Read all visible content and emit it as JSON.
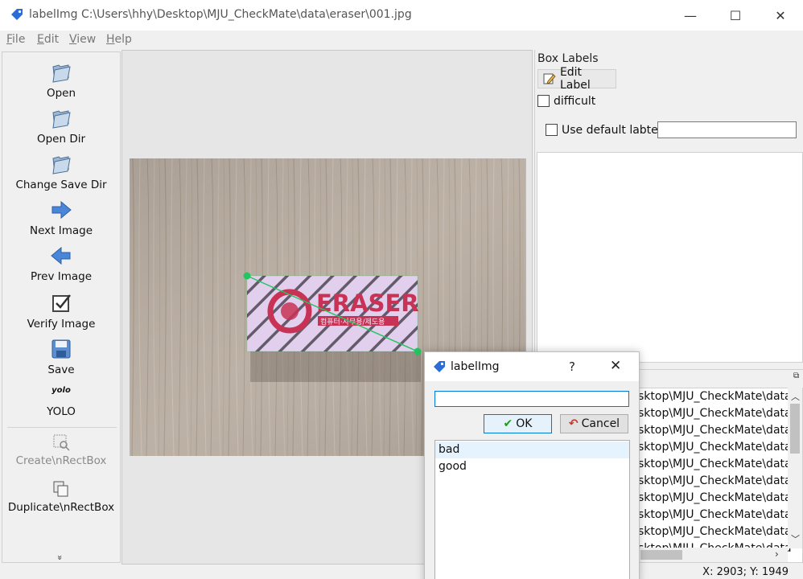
{
  "window": {
    "title": "labelImg C:\\Users\\hhy\\Desktop\\MJU_CheckMate\\data\\eraser\\001.jpg",
    "minimize_glyph": "—",
    "maximize_glyph": "☐",
    "close_glyph": "✕"
  },
  "menu": {
    "file": {
      "mnemonic": "F",
      "rest": "ile"
    },
    "edit": {
      "mnemonic": "E",
      "rest": "dit"
    },
    "view": {
      "mnemonic": "V",
      "rest": "iew"
    },
    "help": {
      "mnemonic": "H",
      "rest": "elp"
    }
  },
  "toolbar": {
    "open": "Open",
    "open_dir": "Open Dir",
    "change_save_dir": "Change Save Dir",
    "next_image": "Next Image",
    "prev_image": "Prev Image",
    "verify_image": "Verify Image",
    "save": "Save",
    "yolo_icon_text": "yolo",
    "yolo": "YOLO",
    "create_rectbox": "Create\\nRectBox",
    "duplicate_rectbox": "Duplicate\\nRectBox",
    "more": "»"
  },
  "canvas": {
    "product_text": "ERASER",
    "product_subtext": "컴퓨터·사무용/제도용"
  },
  "box_labels": {
    "title": "Box Labels",
    "edit_label": "Edit Label",
    "difficult": "difficult",
    "use_default_label": "Use default labtel",
    "default_label_value": ""
  },
  "file_list": {
    "rows": [
      "sktop\\MJU_CheckMate\\data",
      "sktop\\MJU_CheckMate\\data",
      "sktop\\MJU_CheckMate\\data",
      "sktop\\MJU_CheckMate\\data",
      "sktop\\MJU_CheckMate\\data",
      "sktop\\MJU_CheckMate\\data",
      "sktop\\MJU_CheckMate\\data",
      "sktop\\MJU_CheckMate\\data",
      "sktop\\MJU_CheckMate\\data",
      "sktop\\MJU_CheckMate\\data"
    ]
  },
  "dialog": {
    "title": "labelImg",
    "help": "?",
    "close": "✕",
    "input_value": "",
    "ok": "OK",
    "cancel": "Cancel",
    "labels": [
      "bad",
      "good"
    ],
    "selected_index": 0
  },
  "status": {
    "coords": "X: 2903; Y: 1949"
  },
  "colors": {
    "box_outline": "#22c55e",
    "box_fill": "#e9d8f3",
    "product_red": "#c8102e",
    "selection": "#e5f3ff",
    "focus_blue": "#0078d7"
  }
}
